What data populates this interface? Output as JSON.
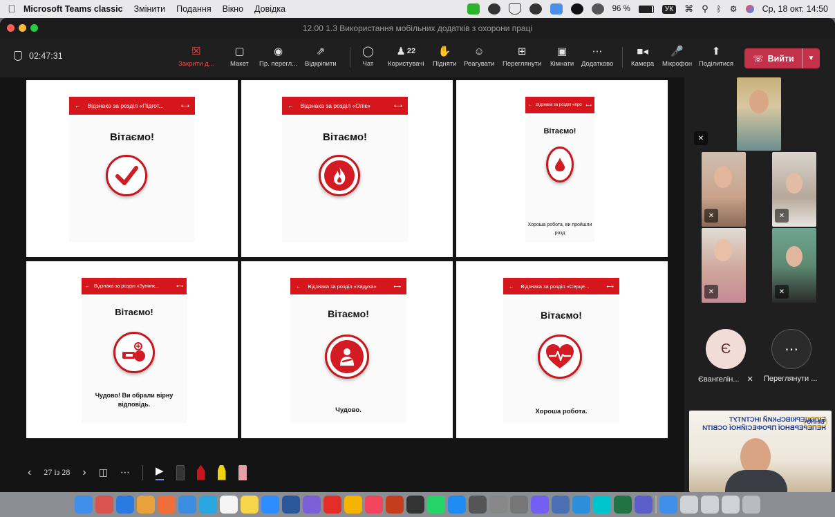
{
  "menubar": {
    "app_name": "Microsoft Teams classic",
    "menus": [
      "Змінити",
      "Подання",
      "Вікно",
      "Довідка"
    ],
    "battery": "96 %",
    "keyboard_layout": "УК",
    "datetime": "Ср, 18 окт. 14:50"
  },
  "window": {
    "title": "12.00 1.3 Використання мобільних додатків з охорони праці"
  },
  "toolbar": {
    "timer": "02:47:31",
    "close_label": "Закрити д...",
    "layout_label": "Макет",
    "preview_label": "Пр. перегл...",
    "unpin_label": "Відкріпити",
    "chat_label": "Чат",
    "people_label": "Користувачі",
    "people_count": "22",
    "raise_label": "Підняти",
    "react_label": "Реагувати",
    "view_label": "Переглянути",
    "rooms_label": "Кімнати",
    "more_label": "Додатково",
    "camera_label": "Камера",
    "mic_label": "Мікрофон",
    "share_label": "Поділитися",
    "leave_label": "Вийти"
  },
  "slides": [
    {
      "bar_title": "Відзнака за розділ «Підгот...",
      "greeting": "Вітаємо!",
      "icon": "checkmark-icon",
      "caption": ""
    },
    {
      "bar_title": "Відзнака за розділ «Опік»",
      "greeting": "Вітаємо!",
      "icon": "fire-icon",
      "caption": ""
    },
    {
      "bar_title": "Відзнака за розділ «Крово...",
      "greeting": "Вітаємо!",
      "icon": "blood-drop-icon",
      "caption": "Хороша робота, ви пройшли розд"
    },
    {
      "bar_title": "Відзнака за розділ «Зупинк...",
      "greeting": "Вітаємо!",
      "icon": "tourniquet-icon",
      "caption": "Чудово! Ви обрали вірну відповідь."
    },
    {
      "bar_title": "Відзнака за розділ «Задуха»",
      "greeting": "Вітаємо!",
      "icon": "choking-person-icon",
      "caption": "Чудово."
    },
    {
      "bar_title": "Відзнака за розділ «Серце...",
      "greeting": "Вітаємо!",
      "icon": "heart-pulse-icon",
      "caption": "Хороша робота."
    }
  ],
  "share_controls": {
    "page_indicator": "27 із 28"
  },
  "participants": {
    "avatar_initial": "Є",
    "avatar_name": "Євангелін...",
    "more_name": "Переглянути ...",
    "banner_line1": "БІЛОЦЕРКІВСЬКИЙ ІНСТИТУТ",
    "banner_line2": "НЕПЕРЕРВНОЇ ПРОФЕСІЙНОЇ ОСВІТИ",
    "banner_logo": "БІНПО"
  },
  "colors": {
    "accent_red": "#d5161d",
    "leave_red": "#c4314b",
    "window_bg": "#1f1f1f"
  }
}
